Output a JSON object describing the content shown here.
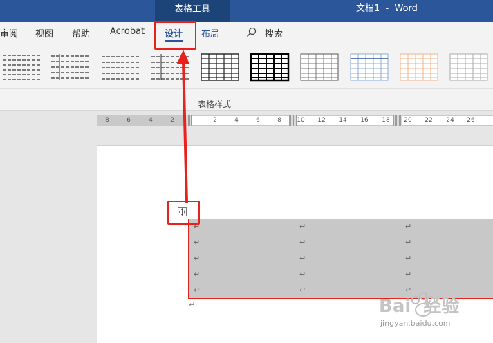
{
  "titlebar": {
    "context_tab": "表格工具",
    "doc_title": "文档1  -  Word"
  },
  "tabs": {
    "review": "审阅",
    "view": "视图",
    "help": "帮助",
    "acrobat": "Acrobat",
    "design": "设计",
    "layout": "布局",
    "search": "搜索"
  },
  "ribbon": {
    "group_label": "表格样式",
    "gallery_count": 10
  },
  "ruler": {
    "left_numbers": [
      "8",
      "6",
      "4",
      "2"
    ],
    "right_numbers": [
      "2",
      "4",
      "6",
      "8",
      "10",
      "12",
      "14",
      "16",
      "18",
      "20",
      "22",
      "24",
      "26"
    ]
  },
  "table": {
    "rows": 5,
    "cols": 3,
    "cell_mark": "↵",
    "after_mark": "↵",
    "shading": "#c8c8c8"
  },
  "annotation": {
    "color": "#e8211d"
  },
  "watermark": {
    "brand": "Bai  经验",
    "url": "jingyan.baidu.com"
  }
}
